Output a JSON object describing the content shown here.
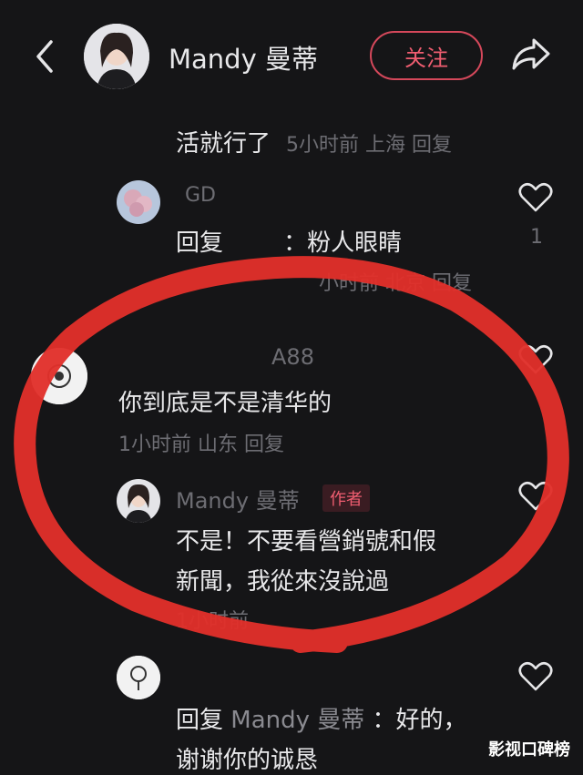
{
  "header": {
    "user_name": "Mandy 曼蒂",
    "follow_label": "关注"
  },
  "comments": [
    {
      "text": "活就行了",
      "meta": "5小时前 上海 回复"
    },
    {
      "user": "GD",
      "text": "回复        ：粉人眼睛",
      "like_count": "1",
      "meta": "小时前 北京 回复"
    },
    {
      "user": "A88",
      "text": "你到底是不是清华的",
      "meta": "1小时前 山东 回复"
    },
    {
      "user": "Mandy 曼蒂",
      "badge": "作者",
      "text_line1": "不是！不要看營銷號和假",
      "text_line2": "新聞，我從來沒說過",
      "meta": "1小时前"
    },
    {
      "reply_prefix": "回复",
      "reply_target": "Mandy 曼蒂",
      "text_line1": "：好的，",
      "text_line2": "谢谢你的诚恳"
    }
  ],
  "watermark": "影视口碑榜",
  "colors": {
    "background": "#151517",
    "accent": "#ef5d70",
    "annotation": "#e1302b"
  },
  "icons": [
    "back-arrow-icon",
    "share-icon",
    "heart-icon"
  ]
}
